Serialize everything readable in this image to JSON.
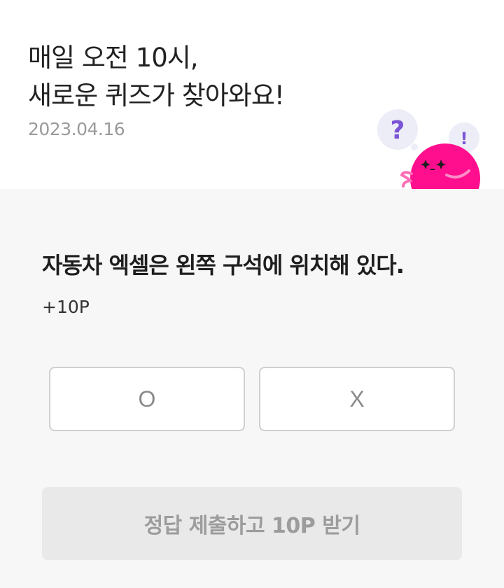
{
  "header": {
    "headline_line1": "매일 오전 10시,",
    "headline_line2": "새로운 퀴즈가 찾아와요!",
    "date": "2023.04.16"
  },
  "mascot": {
    "question_mark": "?",
    "exclamation_mark": "!",
    "body_color": "#ff0f8e",
    "question_color": "#7b55d6",
    "bubble_color": "#ededf7"
  },
  "quiz": {
    "question": "자동차 엑셀은 왼쪽 구석에 위치해 있다.",
    "points": "+10P",
    "options": {
      "o_label": "O",
      "x_label": "X"
    },
    "submit_label": "정답 제출하고 10P 받기"
  }
}
